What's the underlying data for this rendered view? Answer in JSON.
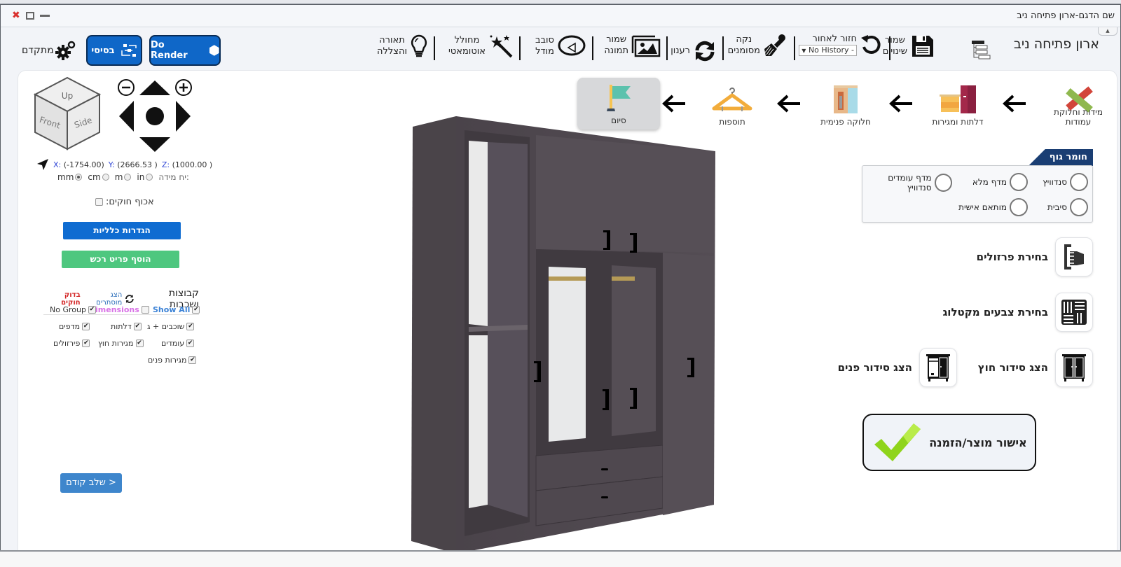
{
  "window": {
    "title": "שם הדגם-ארון פתיחה ניב",
    "controls": {
      "close": "✖",
      "maximize": "maximize",
      "minimize": "minimize"
    },
    "collapse_glyph": "▲"
  },
  "toolbar": {
    "app_name": "ארון פתיחה ניב",
    "items": [
      {
        "id": "save",
        "line1": "שמור",
        "line2": "שינויים",
        "icon": "floppy-disk-icon"
      },
      {
        "id": "undo",
        "line1": "חזור לאחור",
        "select_value": "No History -",
        "select_arrow": "▼",
        "icon": "undo-icon"
      },
      {
        "id": "clear",
        "line1": "נקה",
        "line2": "מסומנים",
        "icon": "paint-brush-icon"
      },
      {
        "id": "refresh",
        "line1": "רענון",
        "icon": "refresh-icon"
      },
      {
        "id": "save-image",
        "line1": "שמור",
        "line2": "תמונה",
        "icon": "image-icon"
      },
      {
        "id": "rotate",
        "line1": "סובב",
        "line2": "מודל",
        "icon": "rotate-icon"
      },
      {
        "id": "auto-gen",
        "line1": "מחולל",
        "line2": "אוטומאטי",
        "icon": "magic-wand-icon"
      },
      {
        "id": "lighting",
        "line1": "תאורה",
        "line2": "והצללה",
        "icon": "light-bulb-icon"
      }
    ],
    "do_render_label": "Do Render",
    "basic_label": "בסיסי",
    "advanced_label": "מתקדם"
  },
  "steps": [
    {
      "label": "מידות וחלוקת עמודות",
      "icon": "ruler-pencil-icon",
      "active": false
    },
    {
      "label": "דלתות ומגירות",
      "icon": "doors-drawers-icon",
      "active": false
    },
    {
      "label": "חלוקה פנימית",
      "icon": "interior-division-icon",
      "active": false
    },
    {
      "label": "תוספות",
      "icon": "hanger-icon",
      "active": false
    },
    {
      "label": "סיום",
      "icon": "finish-flag-icon",
      "active": true
    }
  ],
  "body_material": {
    "title": "חומר גוף",
    "options": [
      {
        "label": "סנדוויץ",
        "selected": false
      },
      {
        "label": "מדף מלא",
        "selected": false
      },
      {
        "label": "מדף עומדים סנדוויץ",
        "selected": false
      },
      {
        "label": "סיבית",
        "selected": false
      },
      {
        "label": "מותאם אישית",
        "selected": false
      }
    ]
  },
  "side_actions": {
    "hardware": "בחירת פרזולים",
    "catalog_colors": "בחירת צבעים מקטלוג",
    "show_exterior": "הצג סידור חוץ",
    "show_interior": "הצג סידור פנים",
    "confirm": "אישור מוצר/הזמנה"
  },
  "view_controls": {
    "cube": {
      "up": "Up",
      "front": "Front",
      "side": "Side"
    },
    "coords": {
      "x_label": "X:",
      "x": "(-1754.00)",
      "y_label": "Y:",
      "y": "(2666.53 )",
      "z_label": "Z:",
      "z": "(1000.00 )"
    },
    "units_label": "יח מידה:",
    "units": [
      {
        "label": "mm",
        "selected": true
      },
      {
        "label": "cm",
        "selected": false
      },
      {
        "label": "m",
        "selected": false
      },
      {
        "label": "in",
        "selected": false
      }
    ],
    "flip_label": "אכוף חוקים:",
    "flip_checked": false
  },
  "left_panel": {
    "general_settings": "הגדרות כלליות",
    "add_furniture": "הוסף פריט רכש",
    "groups_title": "קבוצות ושכבות",
    "show_hidden": "הצג מוסתרים",
    "check_rules": "בדוק חוקים",
    "groups": [
      {
        "label": "Show All",
        "checked": true,
        "color": "#3b82d6"
      },
      {
        "label": "imensions",
        "checked": false,
        "color": "#d872e6"
      },
      {
        "label": "No Group",
        "checked": true,
        "color": "#333333"
      },
      {
        "label": "שוכבים + ג",
        "checked": true,
        "color": "#333333"
      },
      {
        "label": "דלתות",
        "checked": true,
        "color": "#333333"
      },
      {
        "label": "מדפים",
        "checked": true,
        "color": "#333333"
      },
      {
        "label": "עומדים",
        "checked": true,
        "color": "#333333"
      },
      {
        "label": "מגירות חוץ",
        "checked": true,
        "color": "#333333"
      },
      {
        "label": "פירזולים",
        "checked": true,
        "color": "#333333"
      },
      {
        "label": "מגירות פנים",
        "checked": true,
        "color": "#333333"
      }
    ],
    "prev_step": "< שלב קודם"
  },
  "colors": {
    "primary_blue": "#0f67c8",
    "nav_dark": "#1a3e73",
    "green": "#4ec77f",
    "check_green": "#8fd41b",
    "wood": "#4d474d"
  }
}
